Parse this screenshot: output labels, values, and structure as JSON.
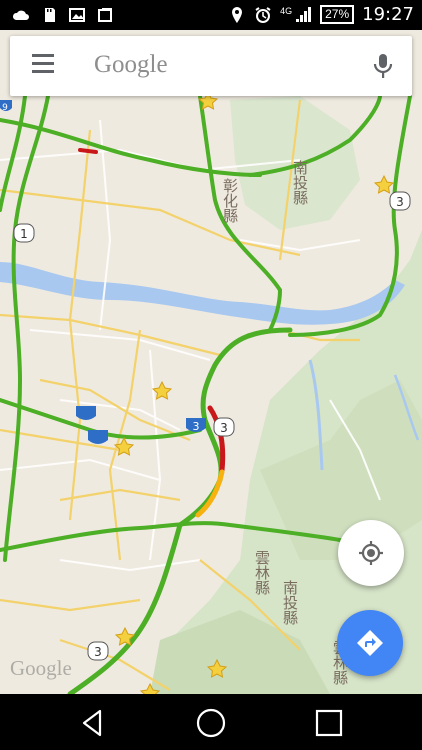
{
  "status_bar": {
    "time": "19:27",
    "battery": "27%",
    "network": "4G"
  },
  "search": {
    "placeholder": "Google"
  },
  "map": {
    "labels": {
      "nantou_north": "南投縣",
      "changhua": "彰化縣",
      "nantou_south": "南投縣",
      "yunlin": "雲林縣",
      "yunlin_south": "雲林縣"
    },
    "shields": {
      "provincial_1": "1",
      "provincial_3_ne": "3",
      "provincial_3_mid": "3",
      "provincial_3_south": "3",
      "national_3": "3",
      "route_9": "9"
    },
    "watermark": "Google"
  },
  "colors": {
    "traffic_fast": "#4caf25",
    "traffic_slow": "#f7b20f",
    "traffic_jam": "#c8181a",
    "fab_directions": "#4285f4",
    "river": "#a8c8f0",
    "terrain": "#d9e6cd"
  },
  "icons": {
    "menu": "menu-icon",
    "mic": "mic-icon",
    "locate": "my-location-icon",
    "directions": "directions-icon",
    "back": "back-icon",
    "home": "home-icon",
    "recents": "recents-icon"
  }
}
